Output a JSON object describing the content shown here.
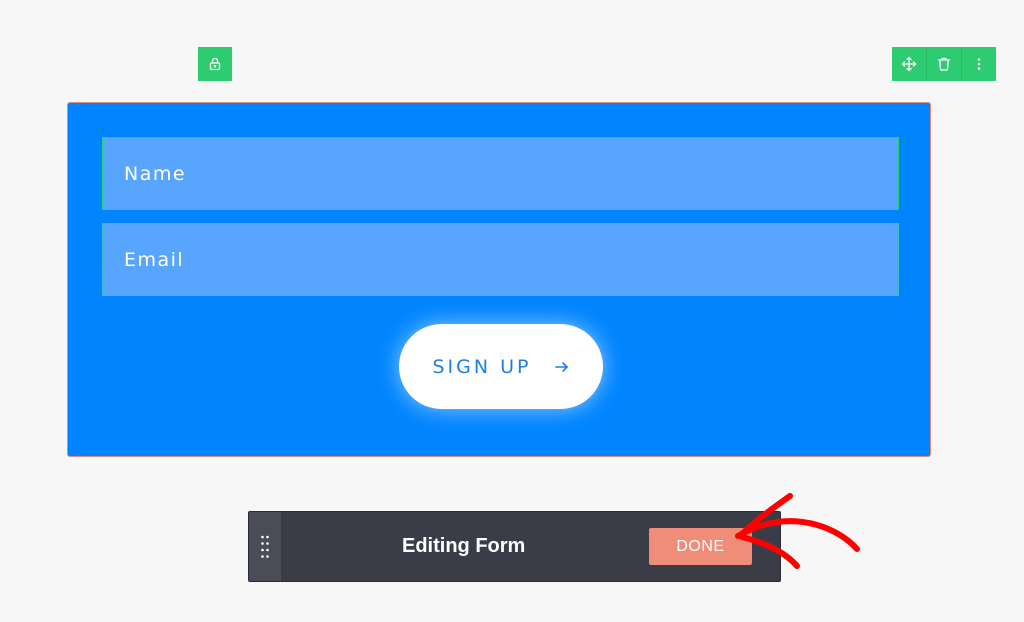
{
  "toolbar": {
    "lock_icon": "lock-icon",
    "actions": [
      "move-icon",
      "trash-icon",
      "more-vertical-icon"
    ]
  },
  "form": {
    "name_placeholder": "Name",
    "email_placeholder": "Email",
    "submit_label": "SIGN UP",
    "submit_icon": "arrow-right-icon",
    "background_color": "#0085ff"
  },
  "edit_bar": {
    "title": "Editing Form",
    "done_label": "DONE",
    "handle_icon": "drag-handle-icon"
  },
  "annotation": {
    "arrow_color": "#ff0000"
  }
}
